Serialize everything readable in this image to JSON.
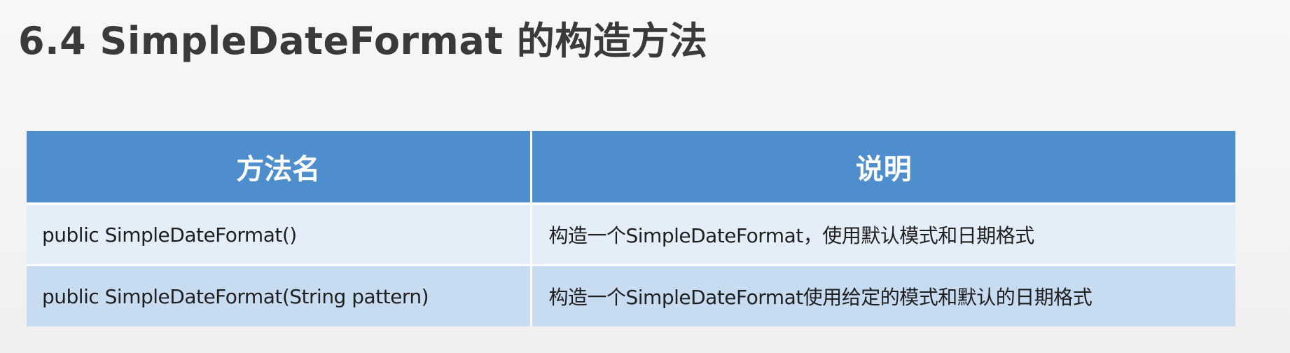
{
  "slide": {
    "title": "6.4 SimpleDateFormat  的构造方法"
  },
  "table": {
    "headers": [
      "方法名",
      "说明"
    ],
    "rows": [
      {
        "method": "public SimpleDateFormat()",
        "description": "构造一个SimpleDateFormat，使用默认模式和日期格式"
      },
      {
        "method": "public SimpleDateFormat(String pattern)",
        "description": "构造一个SimpleDateFormat使用给定的模式和默认的日期格式"
      }
    ]
  },
  "colors": {
    "header_bg": "#4f8ecd",
    "row_light_bg": "#e4eef8",
    "row_dark_bg": "#c7dbf1",
    "title_color": "#3a3a3a"
  }
}
